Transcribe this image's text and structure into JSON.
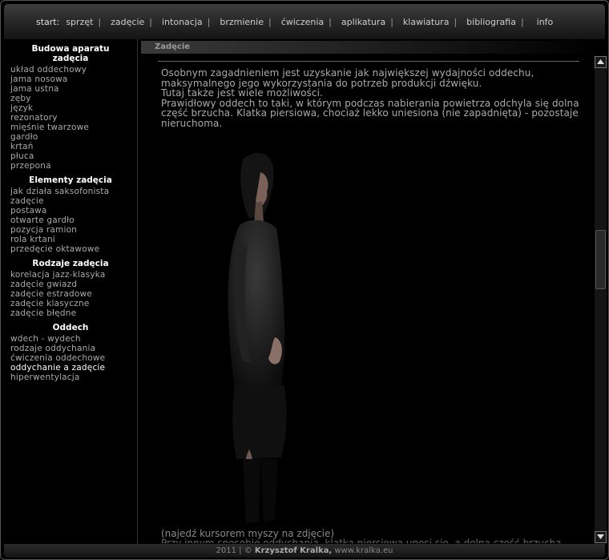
{
  "nav": {
    "start": "start:",
    "items": [
      "sprzęt",
      "zadęcie",
      "intonacja",
      "brzmienie",
      "ćwiczenia",
      "aplikatura",
      "klawiatura",
      "bibliografia"
    ],
    "separator": "|",
    "last": "info"
  },
  "sidebar": {
    "sections": [
      {
        "title": "Budowa aparatu zadęcia",
        "items": [
          "układ oddechowy",
          "jama nosowa",
          "jama ustna",
          "zęby",
          "język",
          "rezonatory",
          "mięśnie twarzowe",
          "gardło",
          "krtań",
          "płuca",
          "przepona"
        ]
      },
      {
        "title": "Elementy zadęcia",
        "items": [
          "jak działa saksofonista",
          "zadęcie",
          "postawa",
          "otwarte gardło",
          "pozycja ramion",
          "rola krtani",
          "przedęcie oktawowe"
        ]
      },
      {
        "title": "Rodzaje zadęcia",
        "items": [
          "korelacja jazz-klasyka",
          "zadęcie gwiazd",
          "zadęcie estradowe",
          "zadęcie klasyczne",
          "zadęcie błędne"
        ]
      },
      {
        "title": "Oddech",
        "items": [
          "wdech - wydech",
          "rodzaje oddychania",
          "ćwiczenia oddechowe",
          "oddychanie a zadęcie",
          "hiperwentylacja"
        ]
      }
    ],
    "active": "oddychanie a zadęcie"
  },
  "main": {
    "heading": "Zadęcie",
    "paragraphs": [
      "Osobnym zagadnieniem jest uzyskanie jak największej wydajności oddechu, maksymalnego jego wykorzystania do potrzeb produkcji dźwięku.",
      "Tutaj także jest wiele możliwości.",
      "Prawidłowy oddech to taki, w którym podczas nabierania powietrza odchyla się dolna część brzucha. Klatka piersiowa, chociaż lekko uniesiona (nie zapadnięta) - pozostaje nieruchoma."
    ],
    "caption": "(najedź kursorem myszy na zdjęcie)",
    "cut_line": "Przy innym sposobie oddychania, klatka piersiowa unosi się, a dolna część brzucha"
  },
  "scroll": {
    "position": 0.4
  },
  "footer": {
    "year": "2011 | ©",
    "author": "Krzysztof Kralka,",
    "site": "www.kralka.eu"
  },
  "colors": {
    "background": "#000000",
    "text": "#aaaaaa",
    "heading": "#ffffff"
  }
}
